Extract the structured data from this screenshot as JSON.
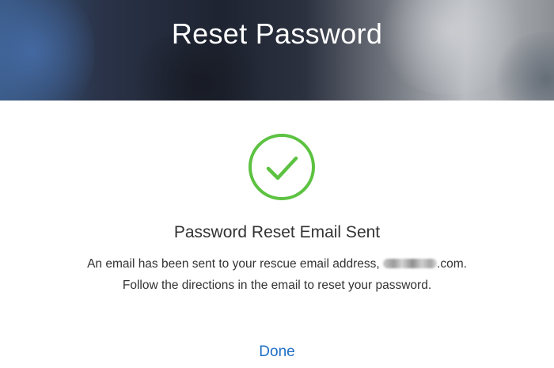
{
  "header": {
    "title": "Reset Password"
  },
  "status": {
    "icon": "checkmark-circle-icon",
    "color": "#5cc241"
  },
  "content": {
    "heading": "Password Reset Email Sent",
    "message_part1": "An email has been sent to your rescue email address, ",
    "masked_email_domain": ".com",
    "message_part2": ". Follow the directions in the email to reset your password."
  },
  "actions": {
    "done_label": "Done",
    "link_color": "#1f6fc5"
  }
}
